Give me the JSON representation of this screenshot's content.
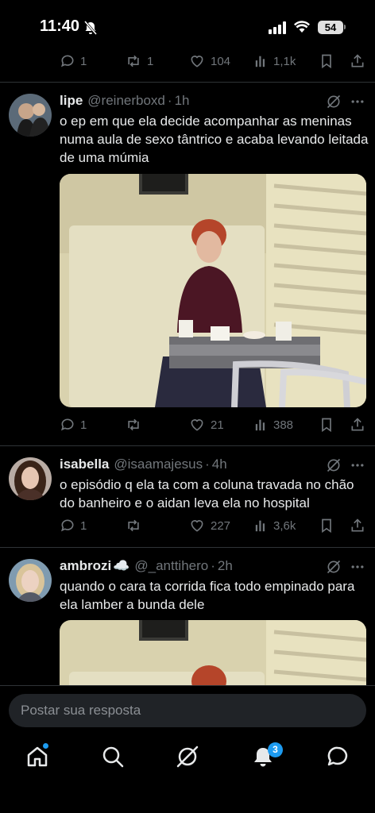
{
  "status": {
    "time": "11:40",
    "battery": "54"
  },
  "top_actions": {
    "replies": "1",
    "reposts": "1",
    "likes": "104",
    "views": "1,1k"
  },
  "tweets": [
    {
      "name": "lipe",
      "handle": "@reinerboxd",
      "time": "1h",
      "text": "o ep em que ela decide acompanhar as meninas numa aula de sexo tântrico e acaba levando leitada de uma múmia",
      "replies": "1",
      "reposts": "",
      "likes": "21",
      "views": "388"
    },
    {
      "name": "isabella",
      "handle": "@isaamajesus",
      "time": "4h",
      "text": "o episódio q ela ta com a coluna travada no chão do banheiro e o aidan leva ela no hospital",
      "replies": "1",
      "reposts": "",
      "likes": "227",
      "views": "3,6k"
    },
    {
      "name": "ambrozi",
      "name_emoji": "☁️",
      "handle": "@_anttihero",
      "time": "2h",
      "text": "quando o cara ta corrida fica todo empinado para ela lamber a bunda dele"
    }
  ],
  "reply": {
    "placeholder": "Postar sua resposta"
  },
  "nav": {
    "notifications_badge": "3"
  },
  "colors": {
    "background": "#000000",
    "accent": "#1d9bf0",
    "muted": "#71767b",
    "text": "#e7e9ea"
  }
}
